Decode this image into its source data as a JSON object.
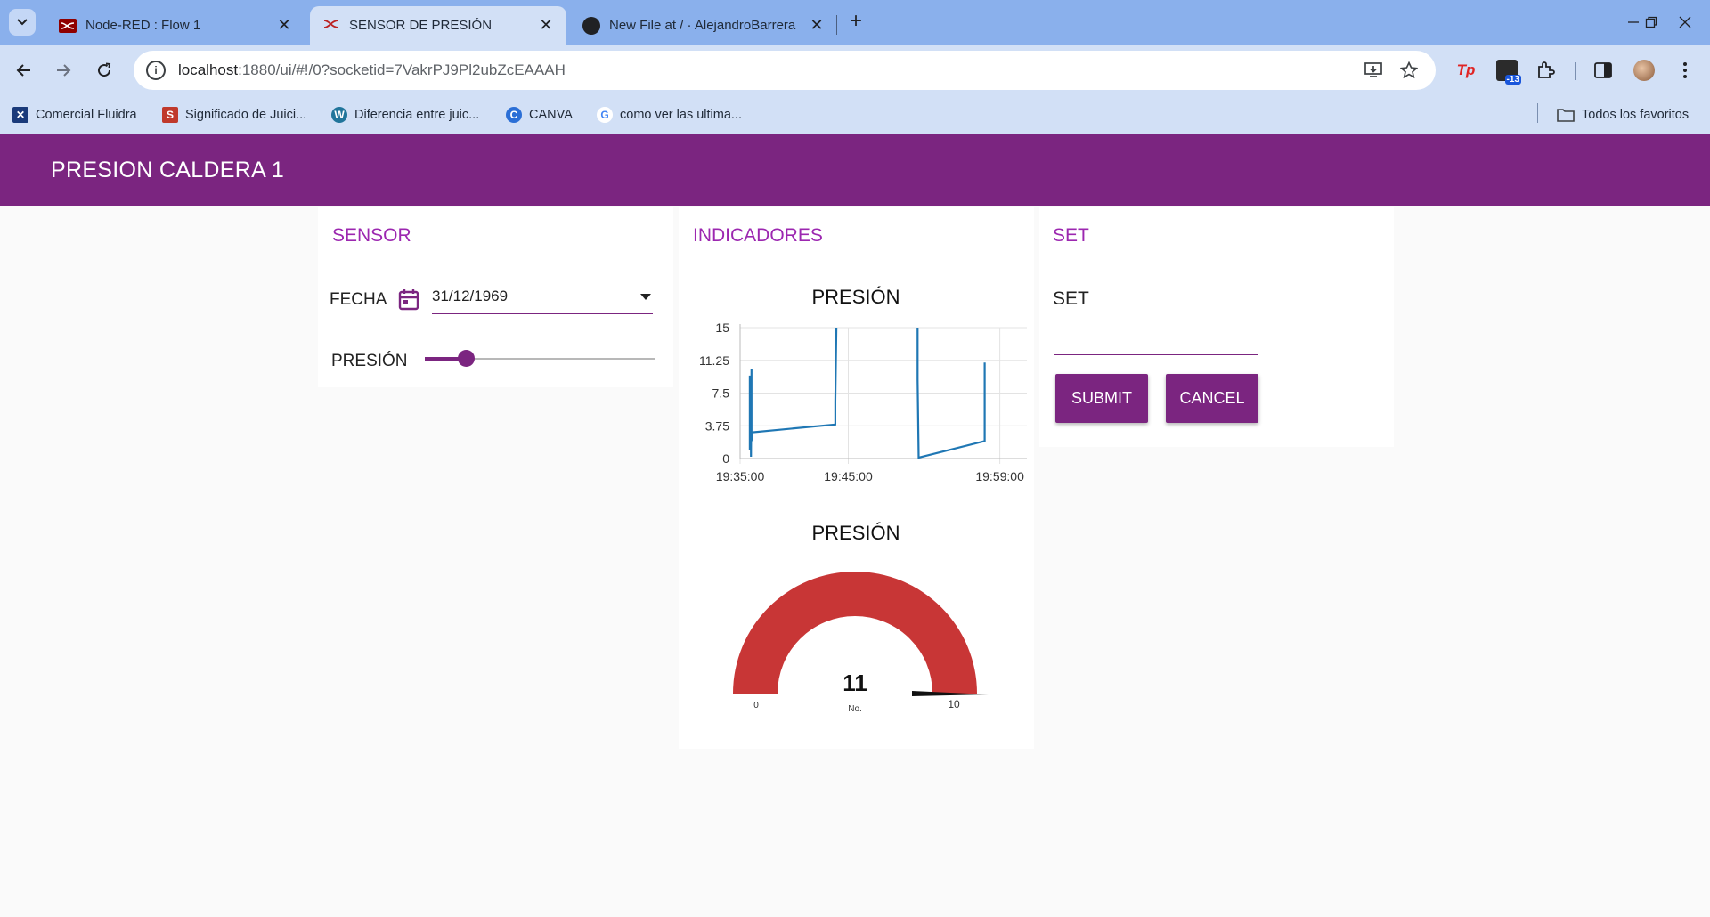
{
  "browser": {
    "tabs": [
      {
        "title": "Node-RED : Flow 1",
        "active": false
      },
      {
        "title": "SENSOR DE PRESIÓN",
        "active": true
      },
      {
        "title": "New File at / · AlejandroBarrera",
        "active": false
      }
    ],
    "url_host": "localhost",
    "url_rest": ":1880/ui/#!/0?socketid=7VakrPJ9Pl2ubZcEAAAH",
    "extension_badge": "-13",
    "bookmarks": [
      {
        "label": "Comercial Fluidra",
        "icon": "fluidra-icon",
        "color": "#1a3a7a"
      },
      {
        "label": "Significado de Juici...",
        "icon": "s-icon",
        "color": "#c0392b"
      },
      {
        "label": "Diferencia entre juic...",
        "icon": "wordpress-icon",
        "color": "#21759b"
      },
      {
        "label": "CANVA",
        "icon": "canva-icon",
        "color": "#2b6fd6"
      },
      {
        "label": "como ver las ultima...",
        "icon": "google-icon",
        "color": "#4285f4"
      }
    ],
    "all_bookmarks_label": "Todos los favoritos"
  },
  "dashboard": {
    "title": "PRESION CALDERA 1",
    "accent_color": "#7b2580",
    "sensor": {
      "group_title": "SENSOR",
      "date_label": "FECHA",
      "date_value": "31/12/1969",
      "slider_label": "PRESIÓN",
      "slider_fraction": 0.18
    },
    "indicadores": {
      "group_title": "INDICADORES",
      "chart_title": "PRESIÓN",
      "gauge_title": "PRESIÓN",
      "gauge": {
        "value": "11",
        "units": "No.",
        "min": "0",
        "max": "10",
        "color": "#c83636"
      }
    },
    "set": {
      "group_title": "SET",
      "input_label": "SET",
      "submit_label": "SUBMIT",
      "cancel_label": "CANCEL"
    }
  },
  "chart_data": {
    "type": "line",
    "title": "PRESIÓN",
    "x_tick_labels": [
      "19:35:00",
      "19:45:00",
      "19:59:00"
    ],
    "x_ticks_minutes": [
      0,
      10,
      24
    ],
    "y_ticks": [
      "0",
      "3.75",
      "7.5",
      "11.25",
      "15"
    ],
    "ylim": [
      0,
      15
    ],
    "xlim_minutes": [
      0,
      26.5
    ],
    "grid": true,
    "series": [
      {
        "color": "#1f77b4",
        "points": [
          [
            0.9,
            9.5
          ],
          [
            0.9,
            1.0
          ],
          [
            1.0,
            9.0
          ],
          [
            1.0,
            0.2
          ],
          [
            1.05,
            10.3
          ],
          [
            1.05,
            2.0
          ],
          [
            1.1,
            3.0
          ],
          [
            8.8,
            3.9
          ],
          [
            8.8,
            6.5
          ],
          [
            8.9,
            15.0
          ]
        ]
      },
      {
        "color": "#1f77b4",
        "points": [
          [
            16.4,
            15.0
          ],
          [
            16.4,
            9.0
          ],
          [
            16.5,
            0.1
          ],
          [
            22.6,
            2.0
          ],
          [
            22.6,
            11.0
          ]
        ]
      }
    ]
  }
}
